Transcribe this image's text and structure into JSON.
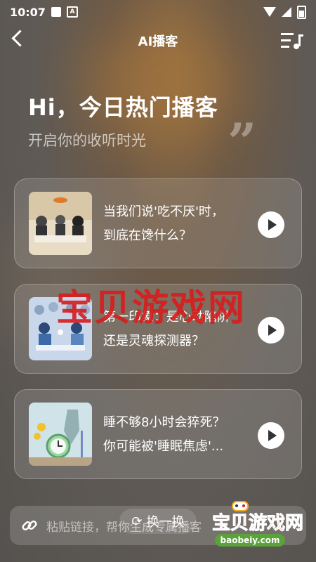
{
  "status": {
    "time": "10:07",
    "notif_icon": "A"
  },
  "header": {
    "title": "AI播客"
  },
  "hero": {
    "title": "Hi，今日热门播客",
    "subtitle": "开启你的收听时光"
  },
  "cards": [
    {
      "line1": "当我们说'吃不厌'时，",
      "line2": "到底在馋什么？"
    },
    {
      "line1": "第一印象：是心动陷阱",
      "line2": "还是灵魂探测器？"
    },
    {
      "line1": "睡不够8小时会猝死？",
      "line2": "你可能被'睡眠焦虑'..."
    }
  ],
  "refresh": {
    "label": "换一换"
  },
  "input": {
    "placeholder": "粘贴链接，帮你生成专属播客"
  },
  "watermark": {
    "text": "宝贝游戏网"
  },
  "logo": {
    "cn": "宝贝游戏网",
    "url": "baobeiy.com"
  },
  "colors": {
    "watermark": "#d81c1c",
    "logo_green": "#5aa23a"
  }
}
